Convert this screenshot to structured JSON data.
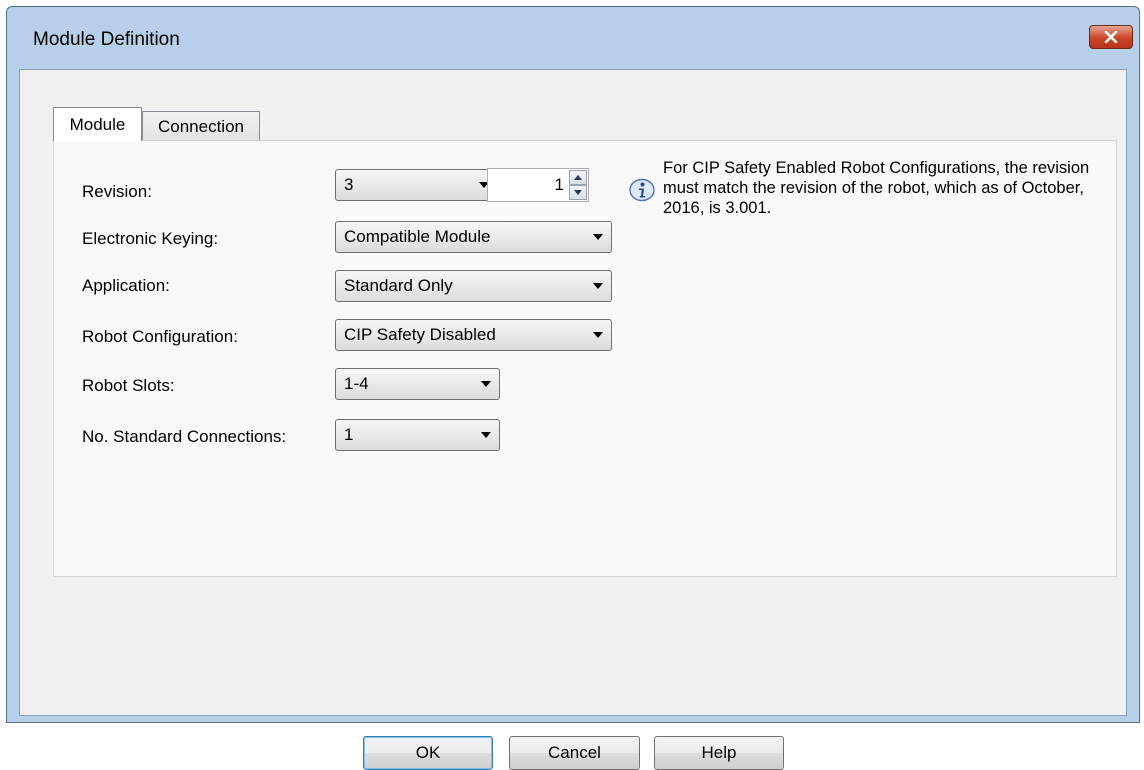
{
  "window": {
    "title": "Module Definition",
    "close_glyph": "✕"
  },
  "tabs": [
    {
      "label": "Module"
    },
    {
      "label": "Connection"
    }
  ],
  "form": {
    "revision": {
      "label": "Revision:",
      "major": "3",
      "minor": "1"
    },
    "electronic_keying": {
      "label": "Electronic Keying:",
      "value": "Compatible Module"
    },
    "application": {
      "label": "Application:",
      "value": "Standard Only"
    },
    "robot_configuration": {
      "label": "Robot Configuration:",
      "value": "CIP Safety Disabled"
    },
    "robot_slots": {
      "label": "Robot Slots:",
      "value": "1-4"
    },
    "standard_connections": {
      "label": "No. Standard Connections:",
      "value": "1"
    }
  },
  "info": {
    "icon": "info-icon",
    "text": "For CIP Safety Enabled Robot Configurations, the revision must match the revision of the robot, which as of October, 2016, is 3.001."
  },
  "buttons": {
    "ok": "OK",
    "cancel": "Cancel",
    "help": "Help"
  },
  "colors": {
    "title_bar": "#b7cfe9",
    "client": "#f0f0f0",
    "close_button": "#c9452b",
    "default_button_border": "#3c7fb1"
  }
}
